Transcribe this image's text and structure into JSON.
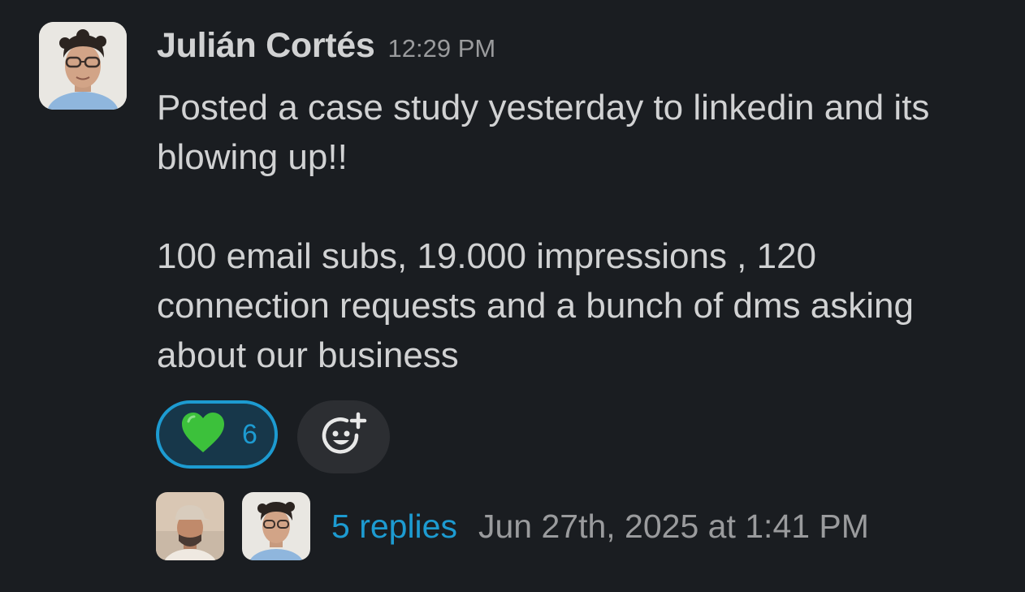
{
  "message": {
    "sender": "Julián Cortés",
    "time": "12:29 PM",
    "paragraphs": [
      "Posted a case study yesterday to linkedin and its blowing up!!",
      "100 email subs, 19.000 impressions , 120 connection requests and a bunch of dms asking about our business"
    ]
  },
  "reactions": [
    {
      "icon": "green-heart-icon",
      "count": "6",
      "color": "#3cc13b"
    }
  ],
  "add_reaction": {
    "icon": "add-reaction-icon"
  },
  "thread": {
    "replies_label": "5 replies",
    "last_reply": "Jun 27th, 2025 at 1:41 PM"
  },
  "colors": {
    "background": "#1a1d21",
    "accent": "#1d9bd1",
    "text": "#d1d2d3",
    "muted": "#9a9b9d"
  }
}
